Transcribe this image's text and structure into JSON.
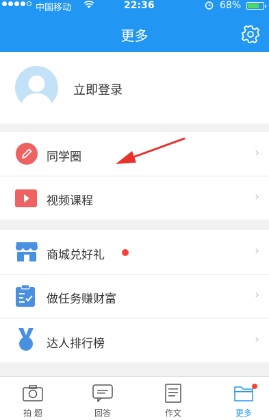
{
  "status_bar": {
    "carrier": "中国移动",
    "time": "22:36",
    "battery_pct": "68%"
  },
  "nav": {
    "title": "更多",
    "settings_icon": "gear-icon"
  },
  "profile": {
    "login_label": "立即登录"
  },
  "menu": [
    {
      "label": "同学圈",
      "icon": "pencil-icon",
      "color": "#f06262"
    },
    {
      "label": "视频课程",
      "icon": "play-video-icon",
      "color": "#f06262"
    },
    {
      "label": "商城兑好礼",
      "icon": "shop-icon",
      "color": "#4a90e2",
      "badge": "red-dot"
    },
    {
      "label": "做任务赚财富",
      "icon": "clipboard-check-icon",
      "color": "#4a90e2"
    },
    {
      "label": "达人排行榜",
      "icon": "medal-icon",
      "color": "#4a90e2"
    }
  ],
  "tabs": [
    {
      "label": "拍 题",
      "icon": "camera-icon"
    },
    {
      "label": "回答",
      "icon": "chat-icon"
    },
    {
      "label": "作文",
      "icon": "document-icon"
    },
    {
      "label": "更多",
      "icon": "folder-icon",
      "active": true
    }
  ],
  "colors": {
    "primary": "#2196f3",
    "accent_red": "#f06262",
    "badge_red": "#f44336"
  }
}
